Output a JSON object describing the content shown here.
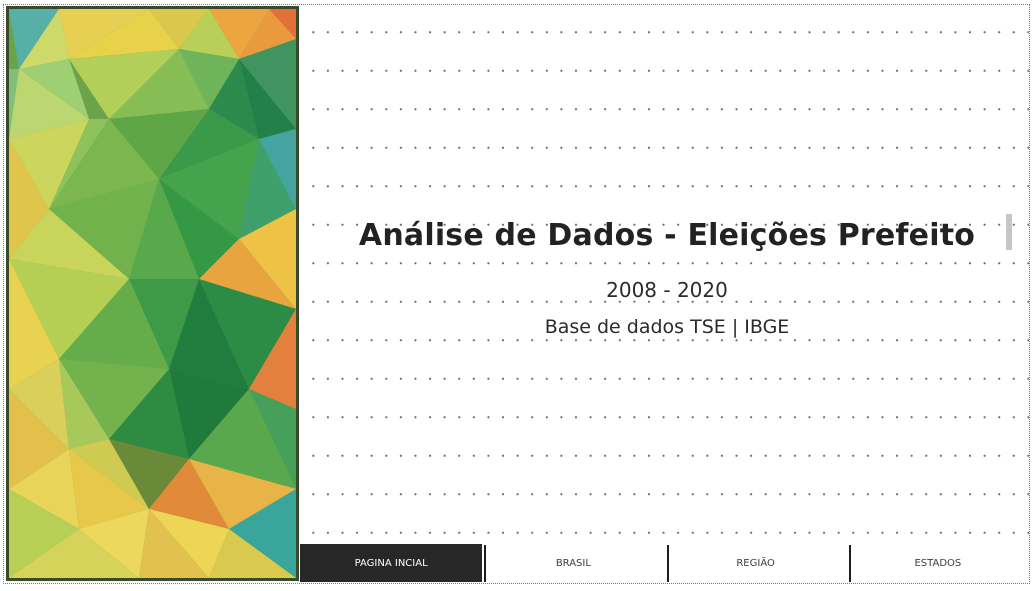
{
  "title": "Análise de Dados - Eleições Prefeito",
  "years": "2008 - 2020",
  "source": "Base de dados TSE | IBGE",
  "nav": [
    {
      "label": "PAGINA INCIAL",
      "active": true
    },
    {
      "label": "BRASIL",
      "active": false
    },
    {
      "label": "REGIÃO",
      "active": false
    },
    {
      "label": "ESTADOS",
      "active": false
    }
  ],
  "colors": {
    "nav_active_bg": "#272727",
    "title": "#222222",
    "art_green_dark": "#1f7a3c",
    "art_yellow": "#e8d24a",
    "art_orange": "#e08a3a",
    "art_teal": "#3aa59a"
  }
}
